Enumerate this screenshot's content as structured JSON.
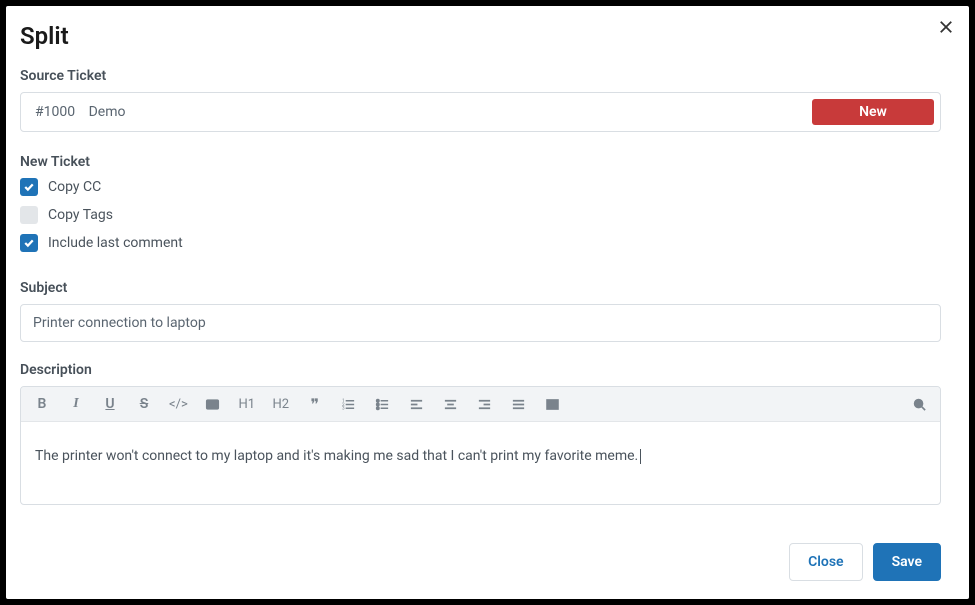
{
  "dialog": {
    "title": "Split"
  },
  "source": {
    "label": "Source Ticket",
    "ticket_id": "#1000",
    "ticket_subject": "Demo",
    "new_button": "New"
  },
  "new_ticket": {
    "label": "New Ticket",
    "options": {
      "copy_cc": {
        "label": "Copy CC",
        "checked": true
      },
      "copy_tags": {
        "label": "Copy Tags",
        "checked": false
      },
      "include_last_comment": {
        "label": "Include last comment",
        "checked": true
      }
    }
  },
  "subject": {
    "label": "Subject",
    "value": "Printer connection to laptop"
  },
  "description": {
    "label": "Description",
    "content": "The printer won't connect to my laptop and it's making me sad that I can't print my favorite meme."
  },
  "toolbar": {
    "bold": "B",
    "italic": "I",
    "underline": "U",
    "strike": "S",
    "code": "</>",
    "codeblock": "code-block",
    "h1": "H1",
    "h2": "H2",
    "quote": "❞",
    "ol": "ordered-list",
    "ul": "unordered-list",
    "left": "align-left",
    "center": "align-center",
    "right": "align-right",
    "justify": "align-justify",
    "table": "table",
    "search": "search"
  },
  "actions": {
    "close": "Close",
    "save": "Save"
  }
}
